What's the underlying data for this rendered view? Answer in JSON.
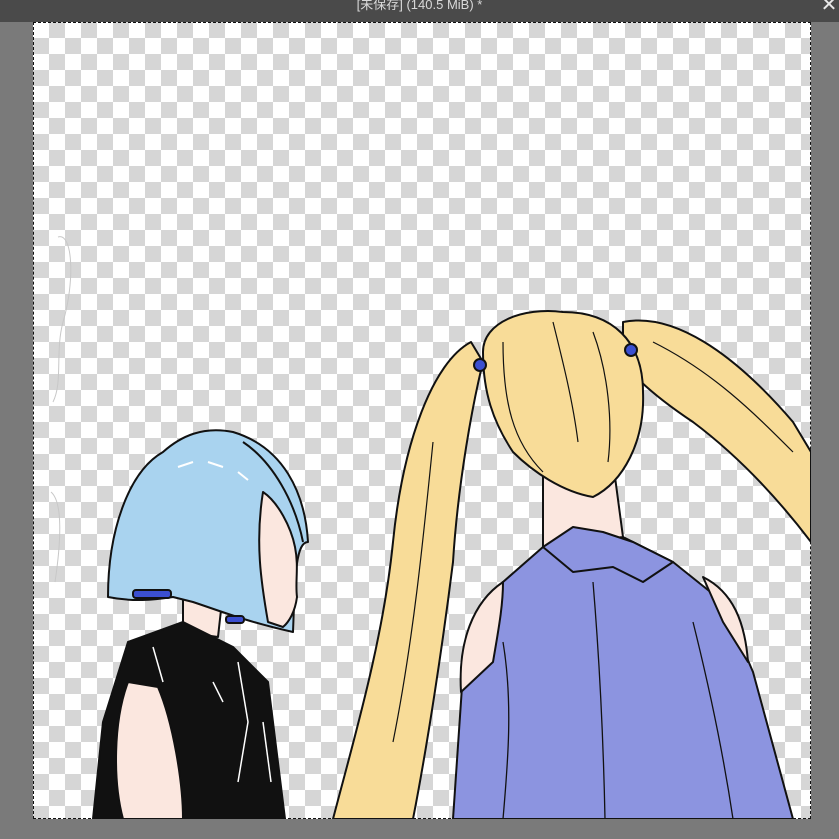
{
  "window": {
    "title": "[未保存] (140.5 MiB) *",
    "close_glyph": "✕"
  },
  "canvas": {
    "background": "transparent-checkerboard",
    "checker_light": "#ffffff",
    "checker_dark": "#d6d6d6",
    "selection": "marquee-full-canvas"
  },
  "artwork": {
    "figures": [
      {
        "name": "short-blue-hair-girl",
        "hair_color": "#a9d3ef",
        "clothing_color": "#111111",
        "skin_color": "#fbe7df"
      },
      {
        "name": "blonde-twintail-girl",
        "hair_color": "#f8dc98",
        "clothing_color": "#8c94e0",
        "skin_color": "#fbe7df"
      }
    ],
    "accent_ties": "#3b4fd0",
    "line_color": "#111111"
  }
}
